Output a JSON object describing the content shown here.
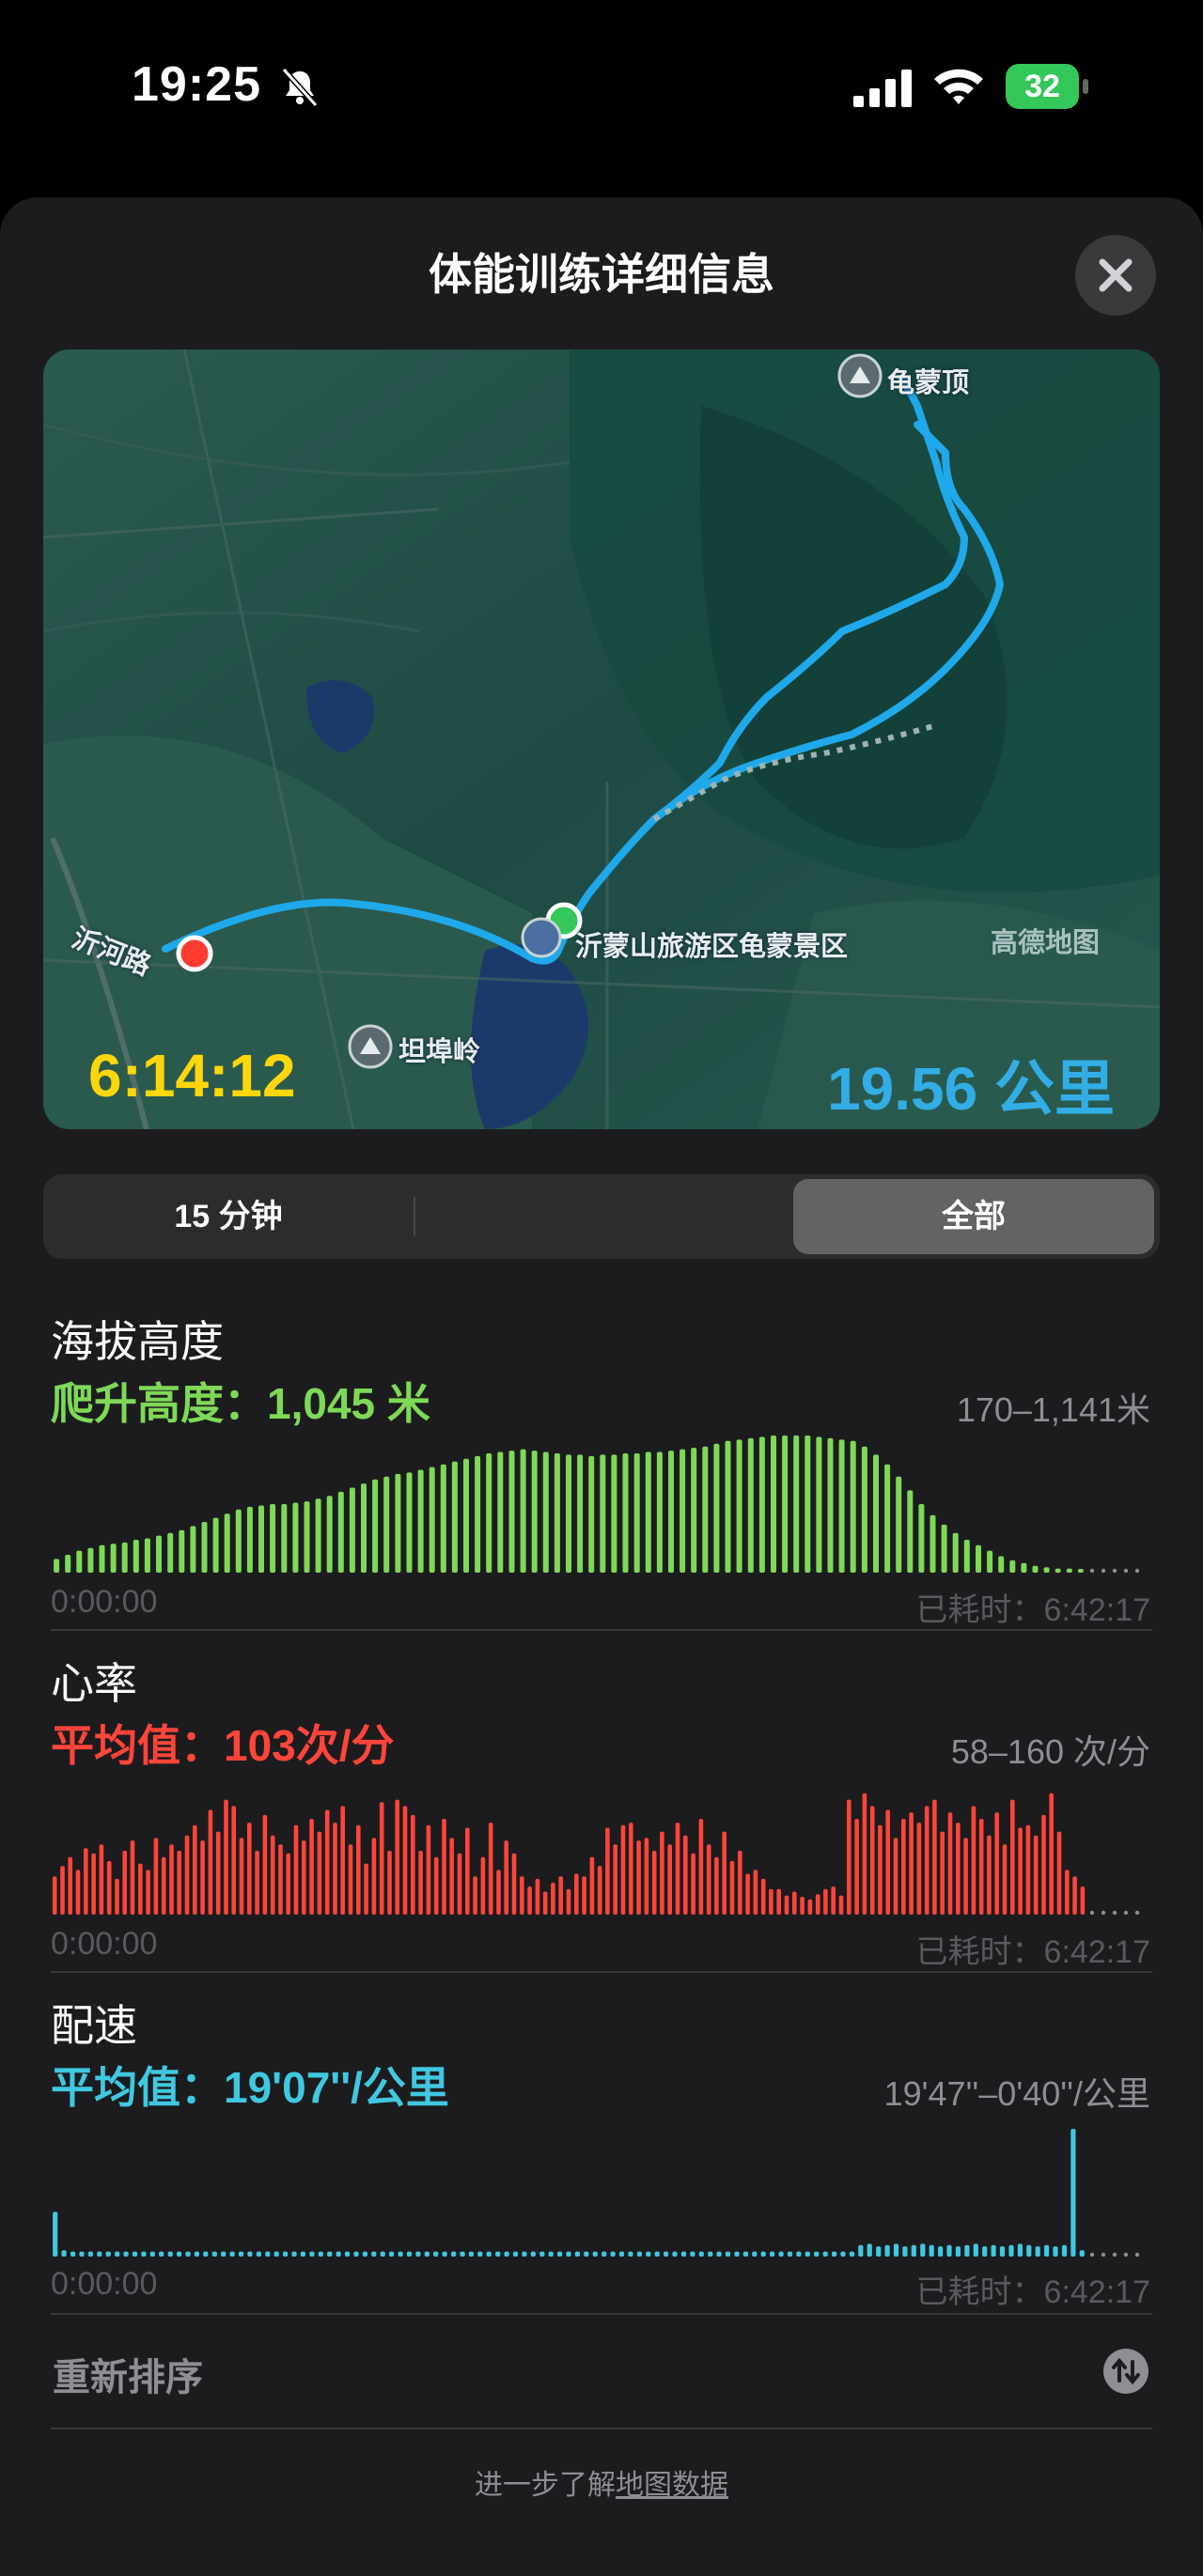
{
  "status_bar": {
    "time": "19:25",
    "battery": "32"
  },
  "sheet": {
    "title": "体能训练详细信息"
  },
  "map": {
    "labels": {
      "peak": "龟蒙顶",
      "scenic_area": "沂蒙山旅游区龟蒙景区",
      "road": "沂河路",
      "village": "坦埠岭",
      "watermark": "高德地图"
    },
    "duration": "6:14:12",
    "distance": "19.56 公里"
  },
  "segmented_control": {
    "options": [
      "15 分钟",
      "",
      "全部"
    ],
    "selected": "全部"
  },
  "sections": {
    "elevation": {
      "title": "海拔高度",
      "summary": "爬升高度：1,045 米",
      "range": "170–1,141米",
      "start_label": "0:00:00",
      "end_label": "已耗时：6:42:17",
      "color": "#7ed957",
      "values": [
        0.1,
        0.13,
        0.16,
        0.18,
        0.2,
        0.21,
        0.22,
        0.24,
        0.25,
        0.27,
        0.29,
        0.31,
        0.34,
        0.37,
        0.4,
        0.43,
        0.46,
        0.48,
        0.49,
        0.5,
        0.5,
        0.51,
        0.52,
        0.54,
        0.56,
        0.59,
        0.62,
        0.65,
        0.68,
        0.7,
        0.72,
        0.73,
        0.75,
        0.77,
        0.79,
        0.81,
        0.83,
        0.85,
        0.87,
        0.88,
        0.89,
        0.9,
        0.89,
        0.88,
        0.87,
        0.86,
        0.86,
        0.85,
        0.86,
        0.86,
        0.87,
        0.87,
        0.88,
        0.88,
        0.89,
        0.9,
        0.91,
        0.92,
        0.94,
        0.96,
        0.97,
        0.98,
        0.99,
        1.0,
        1.0,
        1.0,
        1.0,
        0.99,
        0.98,
        0.97,
        0.96,
        0.92,
        0.86,
        0.79,
        0.7,
        0.6,
        0.5,
        0.42,
        0.35,
        0.29,
        0.24,
        0.2,
        0.16,
        0.12,
        0.09,
        0.07,
        0.05,
        0.04,
        0.03,
        0.03,
        0.02
      ]
    },
    "heart_rate": {
      "title": "心率",
      "summary": "平均值：103次/分",
      "range": "58–160 次/分",
      "start_label": "0:00:00",
      "end_label": "已耗时：6:42:17",
      "color": "#ff453a",
      "values": [
        0.3,
        0.38,
        0.45,
        0.35,
        0.52,
        0.48,
        0.55,
        0.42,
        0.28,
        0.5,
        0.58,
        0.4,
        0.35,
        0.6,
        0.45,
        0.55,
        0.5,
        0.62,
        0.7,
        0.58,
        0.82,
        0.65,
        0.9,
        0.85,
        0.6,
        0.72,
        0.5,
        0.78,
        0.62,
        0.55,
        0.48,
        0.7,
        0.58,
        0.75,
        0.65,
        0.82,
        0.72,
        0.85,
        0.55,
        0.7,
        0.4,
        0.6,
        0.88,
        0.5,
        0.9,
        0.85,
        0.78,
        0.5,
        0.7,
        0.45,
        0.75,
        0.6,
        0.48,
        0.68,
        0.3,
        0.45,
        0.72,
        0.35,
        0.58,
        0.48,
        0.3,
        0.22,
        0.28,
        0.18,
        0.25,
        0.3,
        0.2,
        0.32,
        0.3,
        0.45,
        0.38,
        0.68,
        0.55,
        0.7,
        0.72,
        0.58,
        0.6,
        0.5,
        0.65,
        0.55,
        0.72,
        0.62,
        0.48,
        0.75,
        0.55,
        0.45,
        0.65,
        0.42,
        0.5,
        0.32,
        0.35,
        0.28,
        0.2,
        0.2,
        0.15,
        0.18,
        0.14,
        0.12,
        0.16,
        0.2,
        0.22,
        0.15,
        0.9,
        0.75,
        0.95,
        0.85,
        0.7,
        0.82,
        0.6,
        0.75,
        0.8,
        0.72,
        0.85,
        0.9,
        0.65,
        0.8,
        0.72,
        0.6,
        0.85,
        0.75,
        0.62,
        0.8,
        0.55,
        0.9,
        0.68,
        0.7,
        0.62,
        0.78,
        0.95,
        0.65,
        0.35,
        0.3,
        0.22
      ]
    },
    "pace": {
      "title": "配速",
      "summary": "平均值：19'07''/公里",
      "range": "19'47''–0'40''/公里",
      "start_label": "0:00:00",
      "end_label": "已耗时：6:42:17",
      "color": "#40c8e0",
      "values": [
        0.35,
        0.05,
        0.04,
        0.04,
        0.04,
        0.04,
        0.04,
        0.04,
        0.04,
        0.04,
        0.04,
        0.04,
        0.04,
        0.04,
        0.04,
        0.04,
        0.04,
        0.04,
        0.04,
        0.04,
        0.04,
        0.04,
        0.04,
        0.04,
        0.04,
        0.04,
        0.04,
        0.04,
        0.04,
        0.04,
        0.04,
        0.04,
        0.04,
        0.04,
        0.04,
        0.04,
        0.04,
        0.04,
        0.04,
        0.04,
        0.04,
        0.04,
        0.04,
        0.04,
        0.04,
        0.04,
        0.04,
        0.04,
        0.04,
        0.04,
        0.04,
        0.04,
        0.04,
        0.04,
        0.04,
        0.04,
        0.04,
        0.04,
        0.04,
        0.04,
        0.04,
        0.04,
        0.04,
        0.04,
        0.04,
        0.04,
        0.04,
        0.04,
        0.04,
        0.04,
        0.04,
        0.04,
        0.04,
        0.04,
        0.04,
        0.04,
        0.04,
        0.04,
        0.04,
        0.04,
        0.04,
        0.04,
        0.04,
        0.04,
        0.04,
        0.04,
        0.04,
        0.04,
        0.04,
        0.04,
        0.04,
        0.09,
        0.1,
        0.08,
        0.09,
        0.1,
        0.08,
        0.09,
        0.1,
        0.09,
        0.08,
        0.09,
        0.08,
        0.09,
        0.1,
        0.08,
        0.09,
        0.08,
        0.09,
        0.1,
        0.09,
        0.08,
        0.09,
        0.08,
        0.09,
        1.0,
        0.05
      ]
    }
  },
  "reorder": {
    "label": "重新排序"
  },
  "footer": {
    "prefix": "进一步了解",
    "link": "地图数据"
  }
}
